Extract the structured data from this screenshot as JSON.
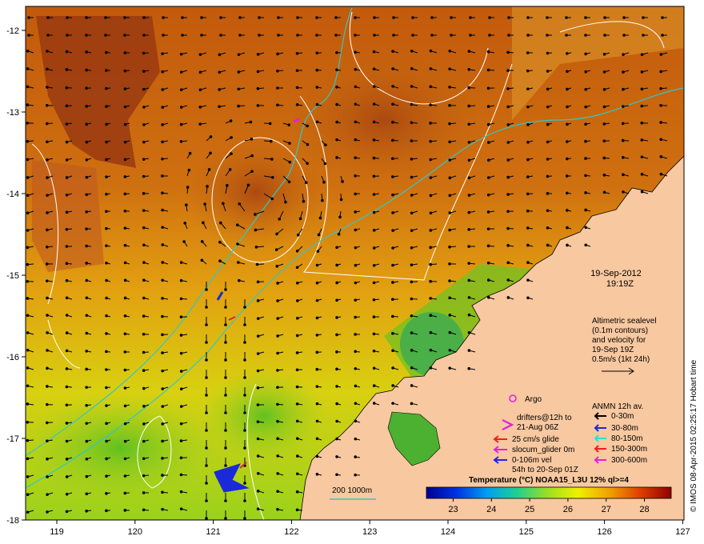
{
  "map": {
    "date": "19-Sep-2012",
    "time": "19:19Z",
    "x_ticks": [
      "119",
      "120",
      "121",
      "122",
      "123",
      "124",
      "125",
      "126",
      "127"
    ],
    "y_ticks": [
      "-12",
      "-13",
      "-14",
      "-15",
      "-16",
      "-17",
      "-18"
    ],
    "altimetry_lines": [
      "Altimetric sealevel",
      "(0.1m contours)",
      "and velocity for",
      "19-Sep 19Z",
      "0.5m/s (1kt 24h)"
    ],
    "argo_label": "Argo",
    "drifters_lines": [
      "drifters@12h to",
      "21-Aug 06Z"
    ],
    "glide_lines": [
      {
        "text": "25 cm/s glide",
        "color": "#ee2020"
      },
      {
        "text": "slocum_glider 0m",
        "color": "#e020e0"
      },
      {
        "text": "0-106m vel",
        "color": "#2020ee"
      }
    ],
    "glide_note": "54h to 20-Sep 01Z",
    "anmn_title": "ANMN 12h av.",
    "anmn_items": [
      {
        "text": "0-30m",
        "color": "#000000"
      },
      {
        "text": "30-80m",
        "color": "#1a2ad8"
      },
      {
        "text": "80-150m",
        "color": "#30e0d0"
      },
      {
        "text": "150-300m",
        "color": "#ee2020"
      },
      {
        "text": "300-600m",
        "color": "#e020e0"
      }
    ],
    "isobath_label": "200  1000m",
    "colorbar_title": "Temperature (°C) NOAA15_L3U 12% ql>=4",
    "colorbar_ticks": [
      "23",
      "24",
      "25",
      "26",
      "27",
      "28"
    ],
    "colorbar_range": [
      22.3,
      28.7
    ],
    "credit": "© IMOS 08-Apr-2015 02:25:17 Hobart time",
    "colors": {
      "land": "#f8c8a0",
      "isobath": "#30c8c8",
      "contour": "#ffffff",
      "argo": "#e020e0",
      "drifter": "#e020e0"
    }
  }
}
